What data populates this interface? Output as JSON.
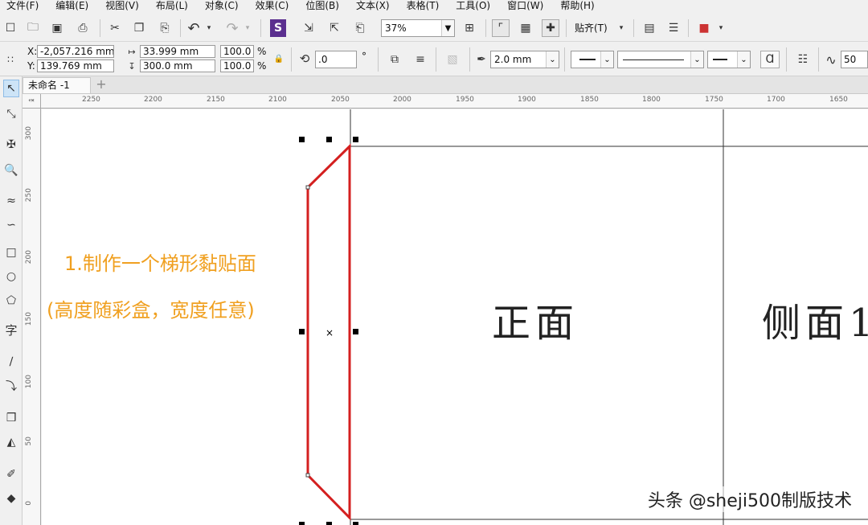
{
  "menu": [
    "文件(F)",
    "编辑(E)",
    "视图(V)",
    "布局(L)",
    "对象(C)",
    "效果(C)",
    "位图(B)",
    "文本(X)",
    "表格(T)",
    "工具(O)",
    "窗口(W)",
    "帮助(H)"
  ],
  "toolbar": {
    "zoom": "37%",
    "snap_label": "贴齐(T)"
  },
  "property_bar": {
    "x_label": "X:",
    "x_value": "-2,057.216 mm",
    "y_label": "Y:",
    "y_value": "139.769 mm",
    "width_value": "33.999 mm",
    "height_value": "300.0 mm",
    "scale_w": "100.0",
    "scale_h": "100.0",
    "percent": "%",
    "rotation": ".0",
    "degree": "°",
    "outline_width": "2.0 mm",
    "smooth_value": "50"
  },
  "document_tab": "未命名 -1",
  "ruler_h": [
    "2250",
    "2200",
    "2150",
    "2100",
    "2050",
    "2000",
    "1950",
    "1900",
    "1850",
    "1800",
    "1750",
    "1700",
    "1650"
  ],
  "ruler_v": [
    "300",
    "250",
    "200",
    "150",
    "100",
    "50",
    "0"
  ],
  "canvas": {
    "front_label": "正面",
    "side_label": "侧面1",
    "annotation_line1": "1.制作一个梯形黏贴面",
    "annotation_line2": "(高度随彩盒，宽度任意)",
    "watermark": "头条 @sheji500制版技术"
  },
  "colors": {
    "trapezoid_outline": "#d42020",
    "annotation": "#f0a020"
  }
}
